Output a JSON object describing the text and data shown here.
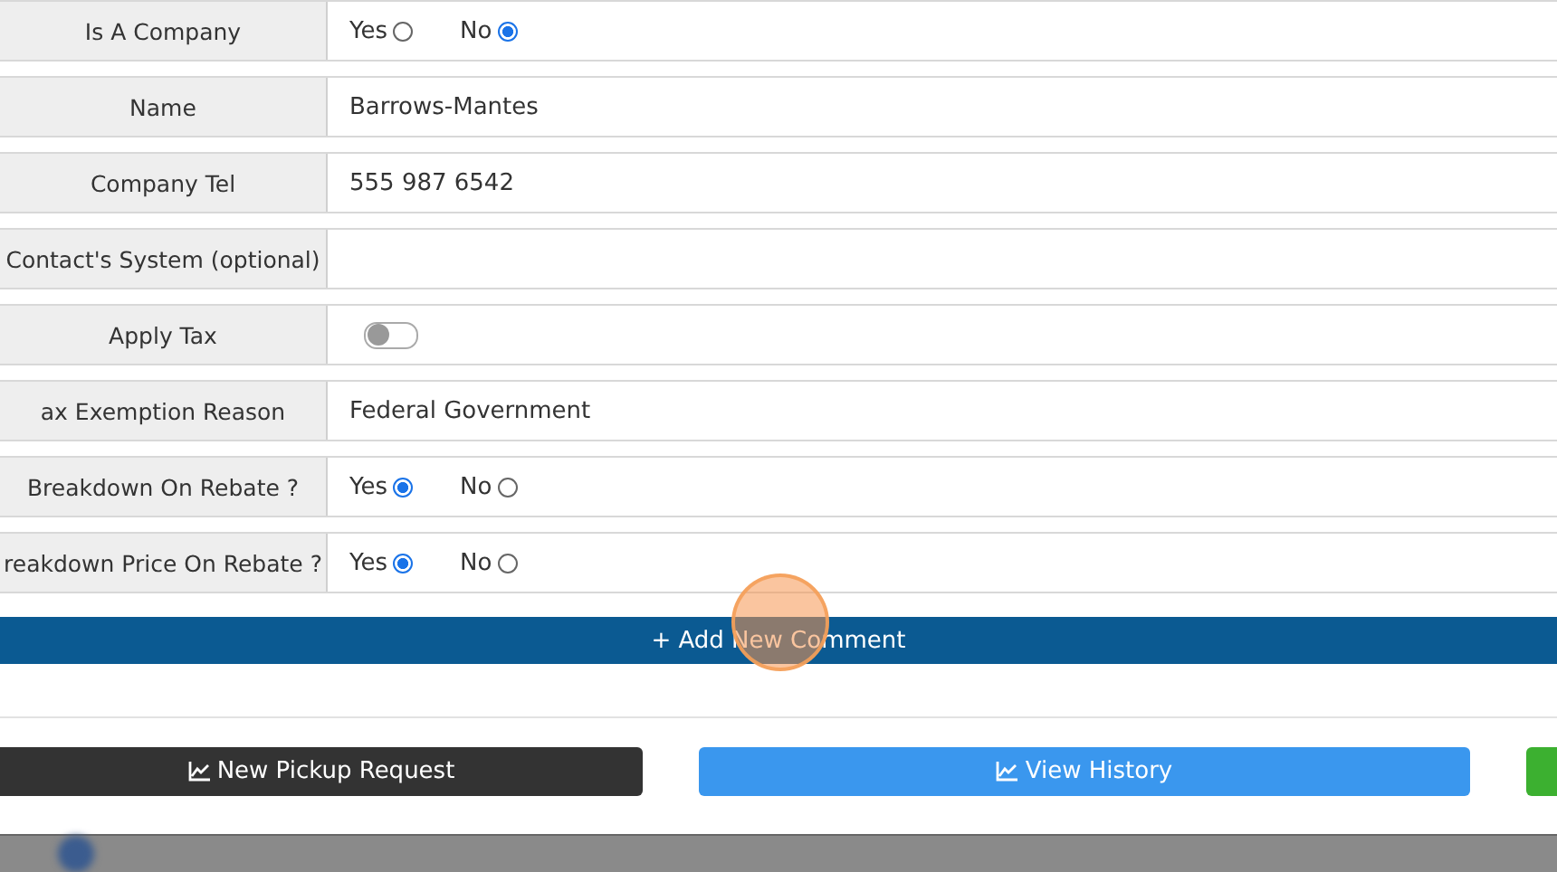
{
  "form_rows": [
    {
      "label": "Is A Company",
      "kind": "radio",
      "options": [
        {
          "label": "Yes",
          "selected": false
        },
        {
          "label": "No",
          "selected": true
        }
      ]
    },
    {
      "label": "Name",
      "kind": "text",
      "value": "Barrows-Mantes"
    },
    {
      "label": "Company Tel",
      "kind": "text",
      "value": "555 987 6542"
    },
    {
      "label": "Contact's System (optional)",
      "kind": "empty"
    },
    {
      "label": "Apply Tax",
      "kind": "toggle",
      "on": false
    },
    {
      "label": "ax Exemption Reason",
      "kind": "text",
      "value": "Federal Government"
    },
    {
      "label": "Breakdown On Rebate ?",
      "kind": "radio",
      "options": [
        {
          "label": "Yes",
          "selected": true
        },
        {
          "label": "No",
          "selected": false
        }
      ]
    },
    {
      "label": "reakdown Price On Rebate ?",
      "kind": "radio",
      "options": [
        {
          "label": "Yes",
          "selected": true
        },
        {
          "label": "No",
          "selected": false
        }
      ]
    }
  ],
  "add_comment_button": "+ Add New Comment",
  "action_buttons": [
    {
      "label": "New Pickup Request",
      "color": "#333333"
    },
    {
      "label": "View History",
      "color": "#3a97ee"
    },
    {
      "color": "#3cb030"
    }
  ]
}
